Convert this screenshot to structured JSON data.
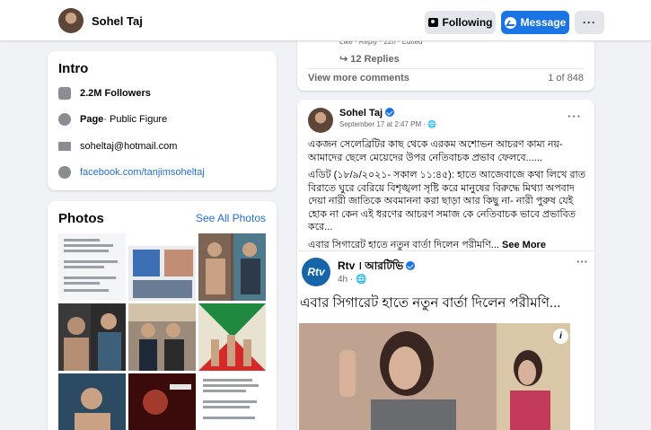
{
  "header": {
    "profile_name": "Sohel Taj",
    "following_label": "Following",
    "message_label": "Message",
    "more_label": "···"
  },
  "intro": {
    "title": "Intro",
    "followers": "2.2M Followers",
    "page_label": "Page",
    "page_category": " · Public Figure",
    "email": "soheltaj@hotmail.com",
    "website": "facebook.com/tanjimsoheltaj"
  },
  "photos": {
    "title": "Photos",
    "see_all": "See All Photos"
  },
  "comment_block": {
    "meta": "Like · Reply · 22h · Edited",
    "replies": "12 Replies",
    "view_more": "View more comments",
    "count": "1 of 848"
  },
  "post": {
    "author": "Sohel Taj",
    "date": "September 17 at 2:47 PM · ",
    "menu": "···",
    "text_1": "একজন সেলেব্রিটির কাছ থেকে এরকম অশোভন আচরণ  কাম্য নয়- আমাদের ছেলে মেয়েদের উপর নেতিবাচক প্রভাব ফেলবে......",
    "text_2": "এডিট (১৮/৯/২০২১- সকাল ১১:৪৫): হাতে আজেবাজে কথা লিখে রাত বিরাতে ঘুরে বেরিয়ে বিশৃঙ্খলা সৃষ্টি করে মানুষের বিরুদ্ধে মিথ্যা অপবাদ দেয়া নারী জাতিকে অবমাননা করা ছাড়া আর কিছু না- নারী পুরুষ যেই হোক না কেন এই ধরণের আচরণ সমাজ কে নেতিবাচক ভাবে প্রভাবিত করে...",
    "text_3": "এবার সিগারেট হাতে নতুন বার্তা দিলেন পরীমণি...",
    "see_more": " See More"
  },
  "shared": {
    "avatar_text": "Rtv",
    "source": "Rtv । আরটিভি",
    "time": "4h · ",
    "menu": "···",
    "headline": "এবার সিগারেট হাতে নতুন বার্তা দিলেন পরীমণি...",
    "info_label": "i"
  },
  "colors": {
    "brand_blue": "#1b74e4",
    "link_blue": "#216fdb",
    "page_bg": "#f0f2f5"
  }
}
